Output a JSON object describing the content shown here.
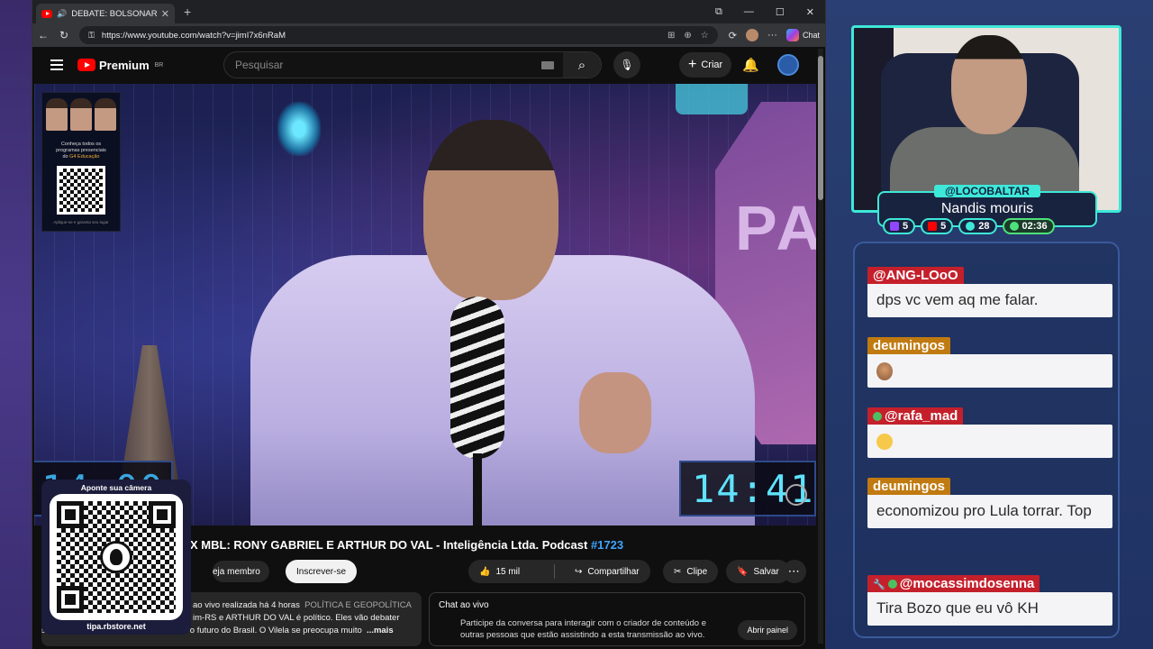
{
  "browser": {
    "tab_title": "DEBATE: BOLSONARISTA X MB",
    "url": "https://www.youtube.com/watch?v=jimI7x6nRaM",
    "chat_label": "Chat"
  },
  "youtube": {
    "logo": "Premium",
    "region": "BR",
    "search_placeholder": "Pesquisar",
    "create_label": "Criar"
  },
  "video": {
    "clock_right": "14:41",
    "clock_left": "14:00",
    "ad": {
      "text1": "Conheça todos os",
      "text2": "programas presenciais",
      "text3_prefix": "do ",
      "text3_brand": "G4 Educação",
      "footer": "Aplique-se e garanta seu lugar"
    },
    "title": "X MBL: RONY GABRIEL E ARTHUR DO VAL - Inteligência Ltda. Podcast",
    "title_hash": "#1723"
  },
  "actions": {
    "join": "eja membro",
    "subscribe": "Inscrever-se",
    "likes": "15 mil",
    "share": "Compartilhar",
    "clip": "Clipe",
    "save": "Salvar"
  },
  "description": {
    "line1": "ao vivo realizada há 4 horas",
    "tags": "POLÍTICA E GEOPOLÍTICA",
    "line2": "im-RS e ARTHUR DO VAL é político. Eles vão debater",
    "line3": "sobre Bolsonaro, a política da direita e o futuro do Brasil. O Vilela se preocupa muito",
    "more": "...mais"
  },
  "live_chat": {
    "title": "Chat ao vivo",
    "text": "Participe da conversa para interagir com o criador de conteúdo e outras pessoas que estão assistindo a esta transmissão ao vivo.",
    "open_panel": "Abrir painel"
  },
  "qr_overlay": {
    "top": "Aponte sua câmera",
    "url": "tipa.rbstore.net"
  },
  "streamer": {
    "handle": "@LOCOBALTAR",
    "name": "Nandis mouris",
    "stats": [
      {
        "icon": "twitch-icon",
        "value": "5",
        "color": "#9146ff"
      },
      {
        "icon": "youtube-icon",
        "value": "5",
        "color": "#ff0000"
      },
      {
        "icon": "kick-icon",
        "value": "28",
        "color": "#3ee8d8"
      },
      {
        "icon": "clock-icon",
        "value": "02:36",
        "color": "#4ee07a"
      }
    ]
  },
  "chat_messages": [
    {
      "user": "@ANG-LOoO",
      "color": "red",
      "text": "dps vc vem aq me falar."
    },
    {
      "user": "deumingos",
      "color": "orange",
      "emoji": "face-emoji"
    },
    {
      "user": "@rafa_mad",
      "color": "red",
      "emoji": "sleepy-emoji"
    },
    {
      "user": "deumingos",
      "color": "orange",
      "text": "economizou pro Lula torrar. Top"
    },
    {
      "user": "@mocassimdosenna",
      "color": "red",
      "text": "Tira Bozo que eu vô KH"
    }
  ]
}
